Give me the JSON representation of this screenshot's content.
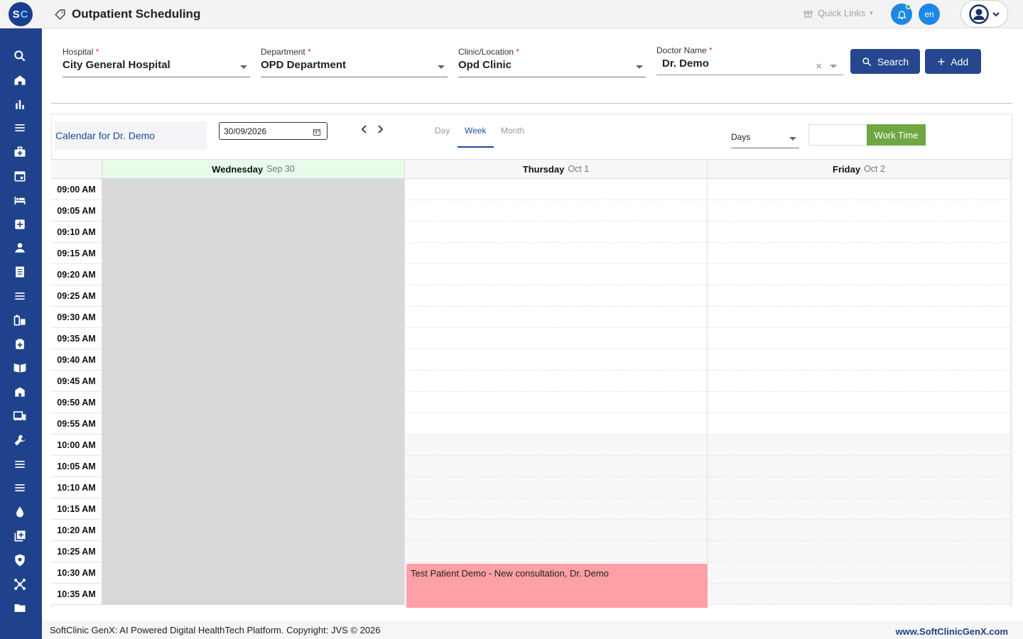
{
  "app": {
    "logo_text_s": "S",
    "logo_text_c": "C",
    "title": "Outpatient Scheduling",
    "quick_links": "Quick Links",
    "lang": "en"
  },
  "sidebar": {
    "items": [
      {
        "name": "search-icon"
      },
      {
        "name": "home-icon"
      },
      {
        "name": "bar-chart-icon"
      },
      {
        "name": "menu-icon"
      },
      {
        "name": "medical-bag-icon"
      },
      {
        "name": "calendar-icon"
      },
      {
        "name": "bed-icon"
      },
      {
        "name": "medical-plus-icon"
      },
      {
        "name": "person-icon"
      },
      {
        "name": "document-icon"
      },
      {
        "name": "menu-icon"
      },
      {
        "name": "pharmacy-icon"
      },
      {
        "name": "medical-box-icon"
      },
      {
        "name": "book-icon"
      },
      {
        "name": "building-icon"
      },
      {
        "name": "devices-icon"
      },
      {
        "name": "wrench-icon"
      },
      {
        "name": "menu-icon"
      },
      {
        "name": "menu-icon"
      },
      {
        "name": "drop-icon"
      },
      {
        "name": "add-box-icon"
      },
      {
        "name": "shield-icon"
      },
      {
        "name": "network-icon"
      },
      {
        "name": "folder-icon"
      }
    ]
  },
  "filters": {
    "hospital": {
      "label": "Hospital",
      "value": "City General Hospital"
    },
    "department": {
      "label": "Department",
      "value": "OPD Department"
    },
    "clinic": {
      "label": "Clinic/Location",
      "value": "Opd Clinic"
    },
    "doctor": {
      "label": "Doctor Name",
      "value": "Dr. Demo"
    },
    "required_mark": "*",
    "search_label": "Search",
    "add_label": "Add"
  },
  "calendar": {
    "title": "Calendar for Dr. Demo",
    "date": "30/09/2026",
    "views": [
      "Day",
      "Week",
      "Month"
    ],
    "active_view": "Week",
    "range_select": "Days",
    "work_time_label": "Work Time",
    "days": [
      {
        "name": "Wednesday",
        "date": "Sep 30"
      },
      {
        "name": "Thursday",
        "date": "Oct 1"
      },
      {
        "name": "Friday",
        "date": "Oct 2"
      }
    ],
    "times": [
      "09:00 AM",
      "09:05 AM",
      "09:10 AM",
      "09:15 AM",
      "09:20 AM",
      "09:25 AM",
      "09:30 AM",
      "09:35 AM",
      "09:40 AM",
      "09:45 AM",
      "09:50 AM",
      "09:55 AM",
      "10:00 AM",
      "10:05 AM",
      "10:10 AM",
      "10:15 AM",
      "10:20 AM",
      "10:25 AM",
      "10:30 AM",
      "10:35 AM"
    ],
    "event": {
      "text": "Test Patient Demo - New consultation, Dr. Demo",
      "color": "#ff9fa6"
    }
  },
  "footer": {
    "copyright": "SoftClinic GenX: AI Powered Digital HealthTech Platform. Copyright: JVS © 2026",
    "website": "www.SoftClinicGenX.com"
  },
  "colors": {
    "brand": "#20428d",
    "accent": "#1e88e5",
    "work_time": "#6fa843"
  }
}
